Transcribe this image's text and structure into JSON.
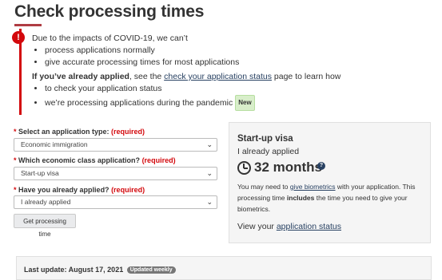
{
  "page": {
    "title": "Check processing times"
  },
  "alert": {
    "icon": "exclamation-circle-icon",
    "intro": "Due to the impacts of COVID-19, we can’t",
    "items": [
      "process applications normally",
      "give accurate processing times for most applications"
    ],
    "applied_bold": "If you’ve already applied",
    "applied_text_before": ", see the ",
    "applied_link": "check your application status",
    "applied_text_after": " page to learn how",
    "items2": [
      "to check your application status",
      "we’re processing applications during the pandemic"
    ],
    "new_badge": "New"
  },
  "form": {
    "q1": {
      "star": "*",
      "label": " Select an application type: ",
      "required": "(required)",
      "value": "Economic immigration"
    },
    "q2": {
      "star": "*",
      "label": " Which economic class application? ",
      "required": "(required)",
      "value": "Start-up visa"
    },
    "q3": {
      "star": "*",
      "label": " Have you already applied? ",
      "required": "(required)",
      "value": "I already applied"
    },
    "submit_label": "Get processing time"
  },
  "result": {
    "title": "Start-up visa",
    "subtitle": "I already applied",
    "time": "32 months",
    "note_before": "You may need to ",
    "note_link": "give biometrics",
    "note_mid": " with your application. This processing time ",
    "note_bold": "includes",
    "note_after": " the time you need to give your biometrics.",
    "view_before": "View your ",
    "view_link": "application status"
  },
  "footer": {
    "last_update": "Last update: August 17, 2021",
    "badge": "Updated weekly"
  }
}
